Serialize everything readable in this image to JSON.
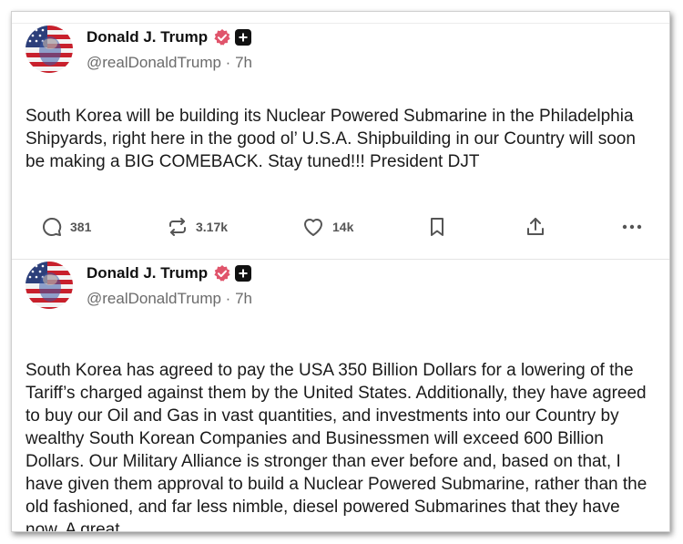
{
  "posts": [
    {
      "author_name": "Donald J. Trump",
      "handle_time": "@realDonaldTrump · 7h",
      "body": "South Korea will be building its Nuclear Powered Submarine in the Philadelphia Shipyards, right here in the good ol’ U.S.A. Shipbuilding in our Country will soon be making a BIG COMEBACK. Stay tuned!!! President DJT",
      "replies": "381",
      "reposts": "3.17k",
      "likes": "14k"
    },
    {
      "author_name": "Donald J. Trump",
      "handle_time": "@realDonaldTrump · 7h",
      "body": "South Korea has agreed to pay the USA 350 Billion Dollars for a lowering of the Tariff’s charged against them by the United States. Additionally, they have agreed to buy our Oil and Gas in vast quantities, and investments into our Country by wealthy South Korean Companies and Businessmen will exceed 600 Billion Dollars. Our Military Alliance is stronger than ever before and, based on that, I have given them approval to build a Nuclear Powered Submarine, rather than the old fashioned, and far less nimble, diesel powered Submarines that they have now. A great"
    }
  ],
  "icons": {
    "verified": "verified-badge-icon",
    "plus": "plus-badge-icon",
    "reply": "reply-icon",
    "repost": "repost-icon",
    "like": "heart-icon",
    "bookmark": "bookmark-icon",
    "share": "share-icon",
    "more": "more-icon"
  },
  "colors": {
    "verified": "#e0546b",
    "text": "#1a1a1a",
    "muted": "#6b6b6b",
    "icon": "#555555"
  }
}
